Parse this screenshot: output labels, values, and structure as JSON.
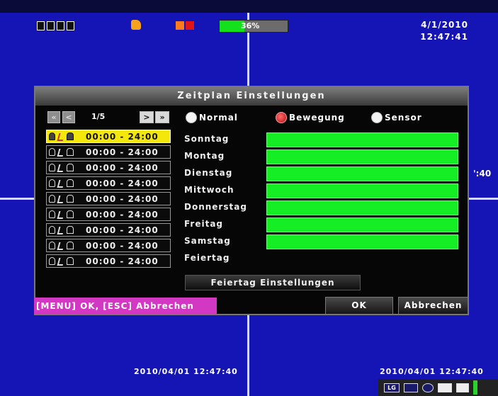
{
  "osd": {
    "hdd_percent": 36,
    "hdd_label": "36%",
    "date": "4/1/2010",
    "time": "12:47:41",
    "side_time": "':40",
    "bottom_left_timestamp": "2010/04/01 12:47:40",
    "bottom_right_timestamp": "2010/04/01 12:47:40",
    "status_icons": [
      "log-icon",
      "display-icon",
      "record-icon",
      "camera-icon",
      "video-icon"
    ],
    "status_log_label": "LG"
  },
  "dialog": {
    "title": "Zeitplan Einstellungen",
    "pager": {
      "first": "«",
      "prev": "<",
      "page": "1/5",
      "next": ">",
      "last": "»"
    },
    "modes": [
      {
        "label": "Normal",
        "selected": false
      },
      {
        "label": "Bewegung",
        "selected": true
      },
      {
        "label": "Sensor",
        "selected": false
      }
    ],
    "slots": [
      {
        "time": "00:00 - 24:00",
        "active": true
      },
      {
        "time": "00:00 - 24:00",
        "active": false
      },
      {
        "time": "00:00 - 24:00",
        "active": false
      },
      {
        "time": "00:00 - 24:00",
        "active": false
      },
      {
        "time": "00:00 - 24:00",
        "active": false
      },
      {
        "time": "00:00 - 24:00",
        "active": false
      },
      {
        "time": "00:00 - 24:00",
        "active": false
      },
      {
        "time": "00:00 - 24:00",
        "active": false
      },
      {
        "time": "00:00 - 24:00",
        "active": false
      }
    ],
    "days": [
      {
        "label": "Sonntag",
        "scheduled": true
      },
      {
        "label": "Montag",
        "scheduled": true
      },
      {
        "label": "Dienstag",
        "scheduled": true
      },
      {
        "label": "Mittwoch",
        "scheduled": true
      },
      {
        "label": "Donnerstag",
        "scheduled": true
      },
      {
        "label": "Freitag",
        "scheduled": true
      },
      {
        "label": "Samstag",
        "scheduled": true
      },
      {
        "label": "Feiertag",
        "scheduled": false
      }
    ],
    "holiday_button": "Feiertag Einstellungen",
    "hint": "[MENU] OK, [ESC] Abbrechen",
    "ok_button": "OK",
    "cancel_button": "Abbrechen"
  },
  "colors": {
    "schedule_bar": "#15ee24",
    "active_slot": "#f3e70b",
    "hint_background": "#d238c2",
    "background": "#1515b5"
  }
}
